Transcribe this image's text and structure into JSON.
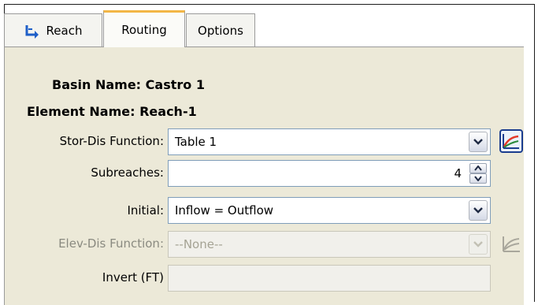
{
  "tabs": [
    {
      "label": "Reach",
      "icon": "reach-icon"
    },
    {
      "label": "Routing"
    },
    {
      "label": "Options"
    }
  ],
  "active_tab": "Routing",
  "basin_name_label": "Basin Name:",
  "basin_name_value": "Castro 1",
  "element_name_label": "Element Name:",
  "element_name_value": "Reach-1",
  "fields": {
    "stor_dis": {
      "label": "Stor-Dis Function:",
      "value": "Table 1",
      "icon": "graph-icon"
    },
    "subreaches": {
      "label": "Subreaches:",
      "value": "4"
    },
    "initial": {
      "label": "Initial:",
      "value": "Inflow = Outflow"
    },
    "elev_dis": {
      "label": "Elev-Dis Function:",
      "value": "--None--",
      "icon": "graph-icon-disabled"
    },
    "invert": {
      "label": "Invert (FT)",
      "value": ""
    }
  },
  "colors": {
    "active_tab_accent": "#f2b646",
    "panel_bg": "#ece9d8"
  }
}
